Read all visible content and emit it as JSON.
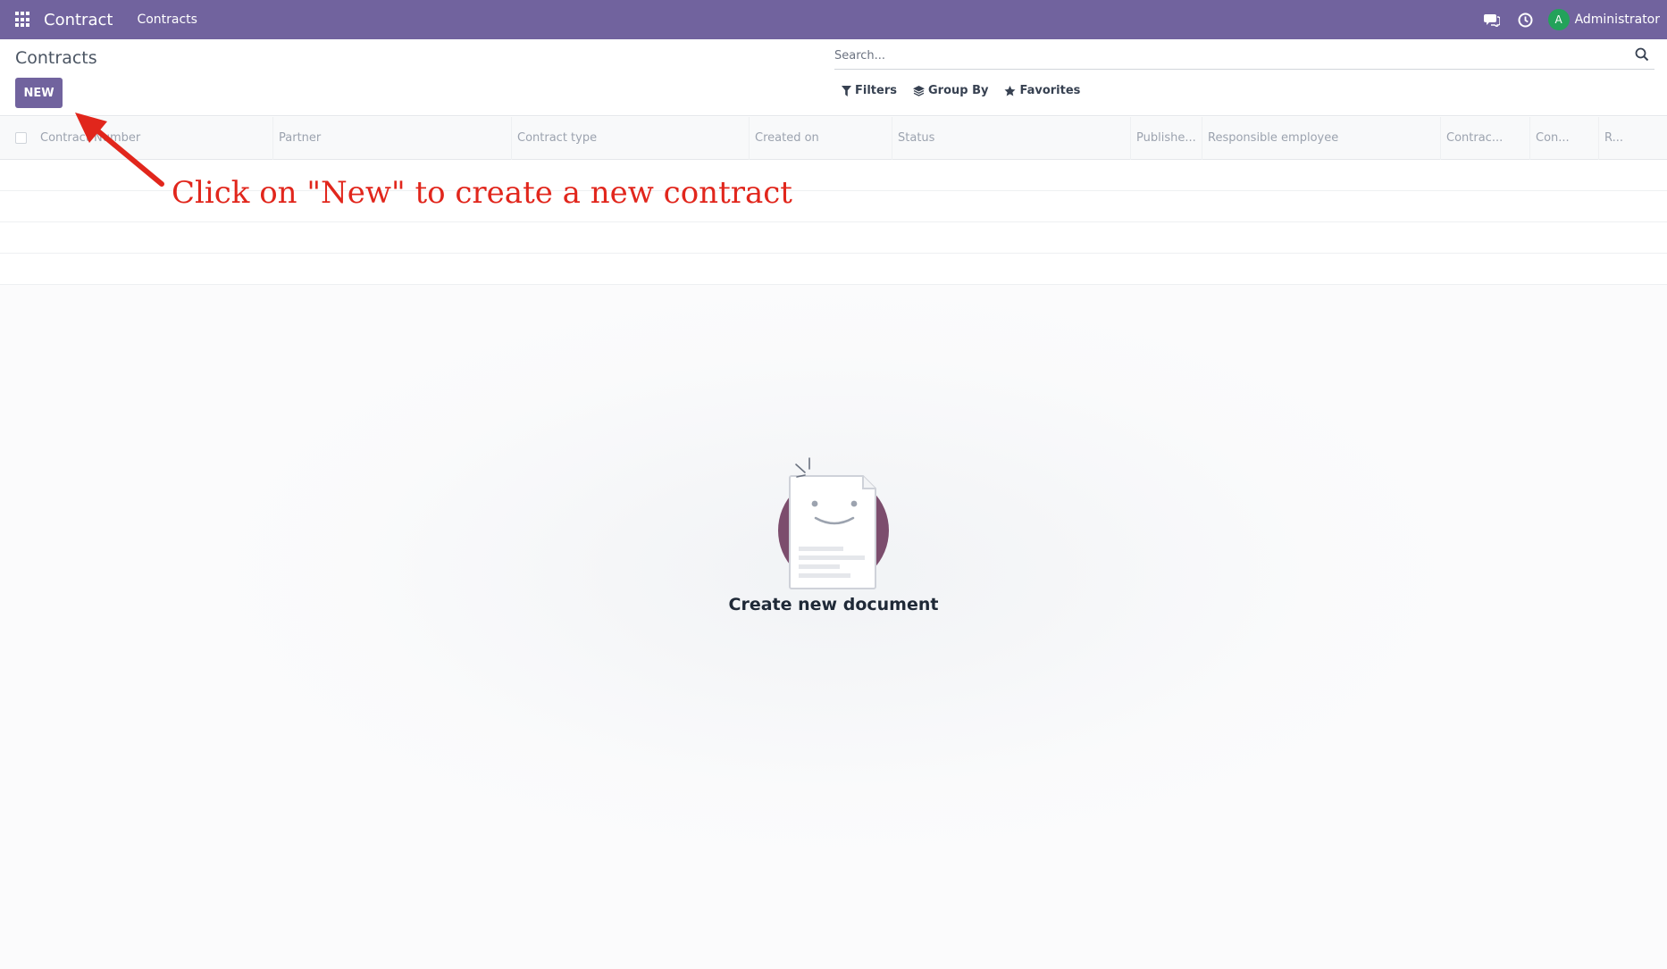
{
  "navbar": {
    "app_name": "Contract",
    "menu_item": "Contracts",
    "user_initial": "A",
    "user_name": "Administrator",
    "icons": [
      "apps-grid-icon",
      "chat-icon",
      "clock-icon"
    ],
    "color": "#71639e"
  },
  "control_panel": {
    "title": "Contracts",
    "new_button": "NEW",
    "search_placeholder": "Search...",
    "filters": "Filters",
    "group_by": "Group By",
    "favorites": "Favorites"
  },
  "list": {
    "columns": [
      "Contract Number",
      "Partner",
      "Contract type",
      "Created on",
      "Status",
      "Publishe...",
      "Responsible employee",
      "Contrac...",
      "Con...",
      "R..."
    ]
  },
  "annotation": {
    "text": "Click on \"New\" to create a new contract",
    "color": "#e1261c"
  },
  "empty_state": {
    "title": "Create new document"
  }
}
